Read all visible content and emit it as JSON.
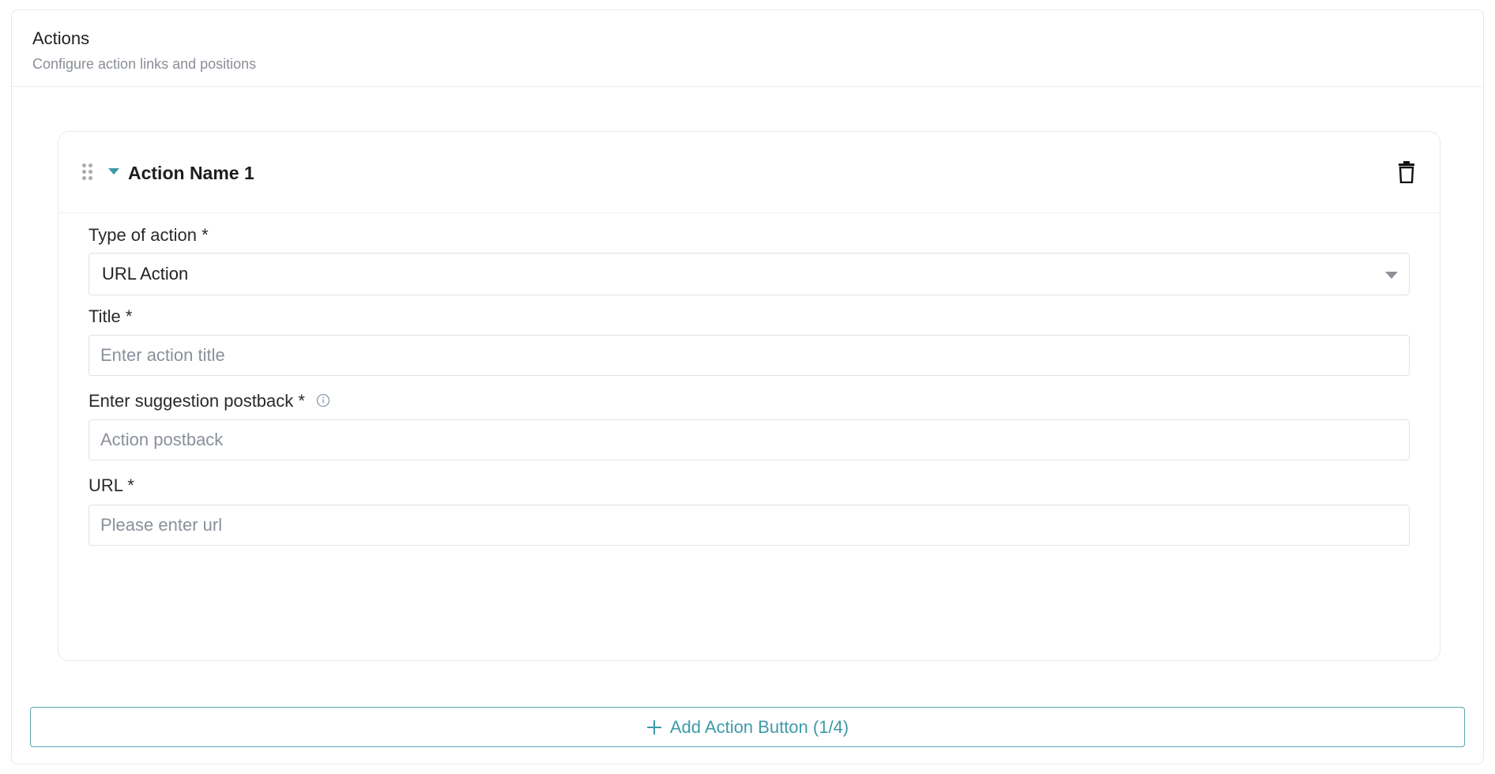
{
  "panel": {
    "title": "Actions",
    "subtitle": "Configure action links and positions"
  },
  "action": {
    "name": "Action Name 1",
    "fields": {
      "type": {
        "label": "Type of action *",
        "value": "URL Action"
      },
      "title": {
        "label": "Title *",
        "placeholder": "Enter action title"
      },
      "postback": {
        "label": "Enter suggestion postback *",
        "placeholder": "Action postback"
      },
      "url": {
        "label": "URL *",
        "placeholder": "Please enter url"
      }
    }
  },
  "add_button": {
    "label": "Add Action Button (1/4)"
  },
  "colors": {
    "accent": "#3e9aa9",
    "border": "#dfe2e6",
    "muted_text": "#8a8f96"
  },
  "icons": {
    "drag": "drag-handle-icon",
    "collapse": "caret-down-icon",
    "delete": "trash-icon",
    "info": "info-icon",
    "add": "plus-icon"
  }
}
